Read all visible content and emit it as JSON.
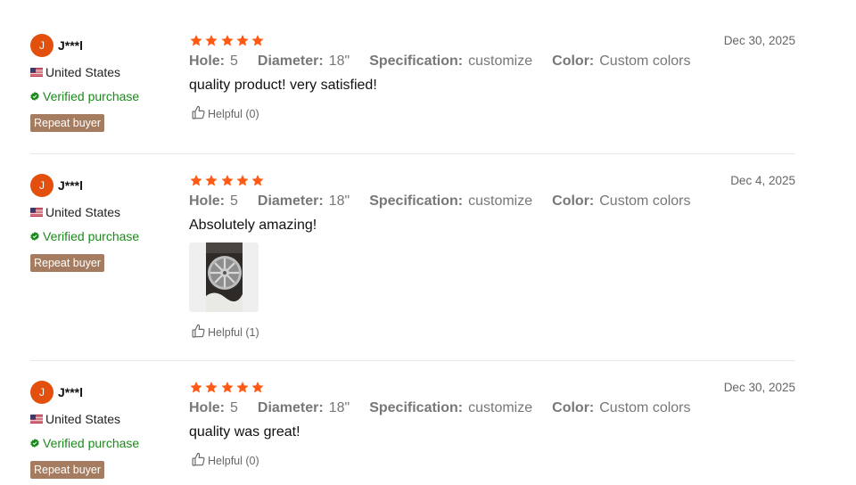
{
  "colors": {
    "avatar": "#e3500e",
    "star": "#ff5a14",
    "verified": "#1a8b1a",
    "badge": "#a57c60"
  },
  "icons": {
    "flag": "us-flag-icon",
    "verified": "verified-icon",
    "star": "star-icon",
    "helpful": "thumbs-up-icon"
  },
  "reviews": [
    {
      "avatar_letter": "J",
      "username": "J***l",
      "country": "United States",
      "verified": "Verified purchase",
      "badge": "Repeat buyer",
      "rating": 5,
      "date": "Dec 30, 2025",
      "specs": [
        {
          "key": "Hole:",
          "value": "5"
        },
        {
          "key": "Diameter:",
          "value": "18\""
        },
        {
          "key": "Specification:",
          "value": "customize"
        },
        {
          "key": "Color:",
          "value": "Custom colors"
        }
      ],
      "comment": "quality product! very satisfied!",
      "helpful": "Helpful (0)"
    },
    {
      "avatar_letter": "J",
      "username": "J***l",
      "country": "United States",
      "verified": "Verified purchase",
      "badge": "Repeat buyer",
      "rating": 5,
      "date": "Dec 4, 2025",
      "specs": [
        {
          "key": "Hole:",
          "value": "5"
        },
        {
          "key": "Diameter:",
          "value": "18\""
        },
        {
          "key": "Specification:",
          "value": "customize"
        },
        {
          "key": "Color:",
          "value": "Custom colors"
        }
      ],
      "comment": "Absolutely amazing!",
      "helpful": "Helpful (1)"
    },
    {
      "avatar_letter": "J",
      "username": "J***l",
      "country": "United States",
      "verified": "Verified purchase",
      "badge": "Repeat buyer",
      "rating": 5,
      "date": "Dec 30, 2025",
      "specs": [
        {
          "key": "Hole:",
          "value": "5"
        },
        {
          "key": "Diameter:",
          "value": "18\""
        },
        {
          "key": "Specification:",
          "value": "customize"
        },
        {
          "key": "Color:",
          "value": "Custom colors"
        }
      ],
      "comment": "quality was great!",
      "helpful": "Helpful (0)"
    }
  ]
}
